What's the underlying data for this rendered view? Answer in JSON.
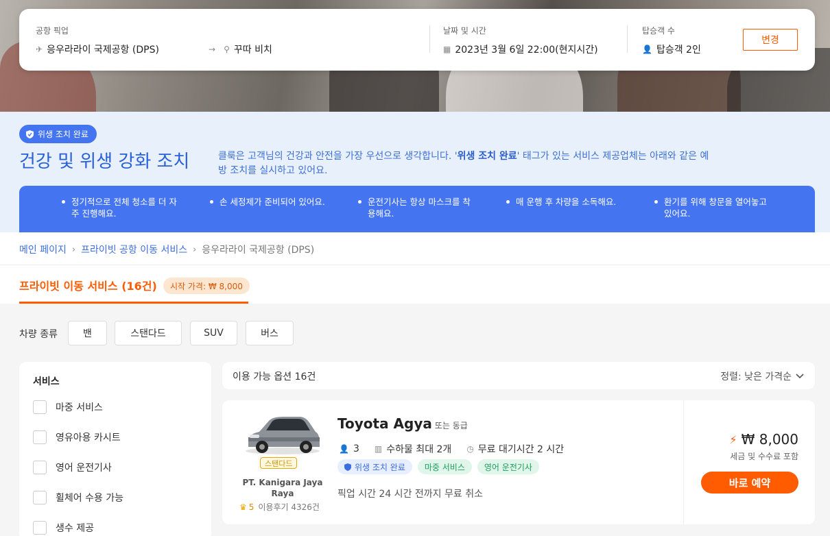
{
  "search": {
    "pickup_label": "공항 픽업",
    "pickup_value": "응우라라이 국제공항 (DPS)",
    "dest_value": "꾸따 비치",
    "date_label": "날짜 및 시간",
    "date_value": "2023년 3월 6일 22:00(현지시간)",
    "pax_label": "탑승객 수",
    "pax_value": "탑승객 2인",
    "change_label": "변경"
  },
  "health": {
    "badge": "위생 조치 완료",
    "title": "건강 및 위생 강화 조치",
    "desc_before": "클룩은 고객님의 건강과 안전을 가장 우선으로 생각합니다. '",
    "desc_bold": "위생 조치 완료",
    "desc_after": "' 태그가 있는 서비스 제공업체는 아래와 같은 예방 조치를 실시하고 있어요.",
    "items": [
      "정기적으로 전체 청소를 더 자주 진행해요.",
      "손 세정제가 준비되어 있어요.",
      "운전기사는 항상 마스크를 착용해요.",
      "매 운행 후 차량을 소독해요.",
      "환기를 위해 창문을 열어놓고 있어요."
    ]
  },
  "breadcrumb": {
    "home": "메인 페이지",
    "category": "프라이빗 공항 이동 서비스",
    "current": "응우라라이 국제공항 (DPS)",
    "sep": "›"
  },
  "tab": {
    "label": "프라이빗 이동 서비스 (16건)",
    "price_pill": "시작 가격: ₩ 8,000"
  },
  "vehicle_types": {
    "label": "차량 종류",
    "options": [
      "밴",
      "스탠다드",
      "SUV",
      "버스"
    ]
  },
  "sidebar": {
    "title": "서비스",
    "items": [
      "마중 서비스",
      "영유아용 카시트",
      "영어 운전기사",
      "휠체어 수용 가능",
      "생수 제공"
    ]
  },
  "results": {
    "count": "이용 가능 옵션 16건",
    "sort": "정렬: 낮은 가격순"
  },
  "card": {
    "car_name": "Toyota Agya",
    "car_suffix": "또는 동급",
    "class_badge": "스탠다드",
    "provider": "PT. Kanigara Jaya Raya",
    "rating": "5",
    "reviews": "이용후기 4326건",
    "seats": "3",
    "luggage": "수하물 최대 2개",
    "wait": "무료 대기시간 2 시간",
    "tags": [
      "위생 조치 완료",
      "마중 서비스",
      "영어 운전기사"
    ],
    "cancel": "픽업 시간 24 시간 전까지 무료 취소",
    "price": "₩ 8,000",
    "price_note": "세금 및 수수료 포함",
    "book": "바로 예약"
  }
}
